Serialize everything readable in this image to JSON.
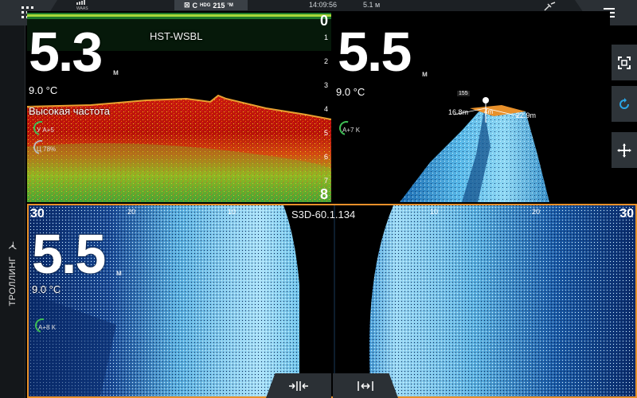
{
  "status": {
    "waas": "WAAS",
    "hdg_prefix": "C",
    "hdg_label": "HDG",
    "hdg_value": "215",
    "hdg_unit": "°M",
    "time": "14:09:56",
    "depth": "5.1 м"
  },
  "sidebar": {
    "trolling_label": "ТРОЛЛИНГ"
  },
  "sonar_panel": {
    "depth": "5.3",
    "unit": "м",
    "temp": "9.0 °C",
    "source": "HST-WSBL",
    "frequency": "Высокая частота",
    "gain_auto": "A+5",
    "gain_prefix": "У",
    "color_prefix": "Ц",
    "color_value": "78%",
    "scale": [
      "0",
      "1",
      "2",
      "3",
      "4",
      "5",
      "6",
      "7",
      "8"
    ]
  },
  "panel_3d": {
    "depth": "5.5",
    "unit": "м",
    "temp": "9.0 °C",
    "gain_auto": "A+7",
    "gain_suffix": "K",
    "label_top": "155",
    "label_left": "16.8m",
    "label_right": "22.9m",
    "label_center": "4m"
  },
  "sidescan_panel": {
    "depth": "5.5",
    "unit": "м",
    "temp": "9.0 °C",
    "source": "S3D-60.1.134",
    "gain_auto": "A+8",
    "gain_suffix": "K",
    "range_left": "30",
    "range_right": "30",
    "ticks_left": [
      "20",
      "10"
    ],
    "ticks_right": [
      "10",
      "20"
    ]
  }
}
